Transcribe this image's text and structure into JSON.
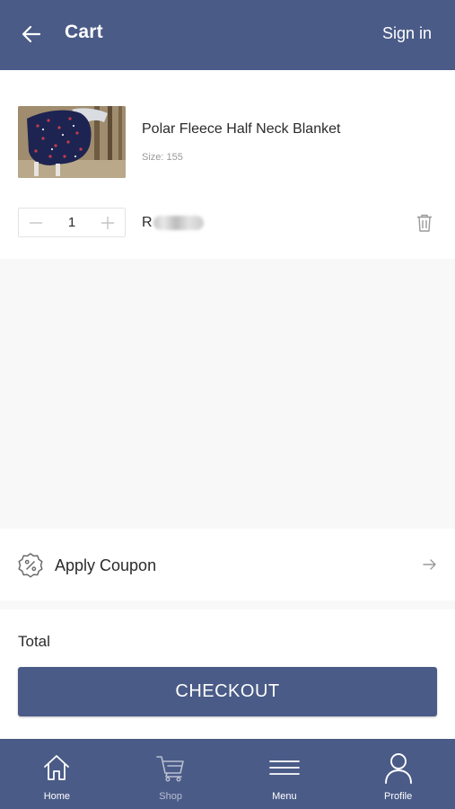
{
  "header": {
    "title": "Cart",
    "sign_in_label": "Sign in",
    "back_icon": "arrow-left-icon"
  },
  "cart": {
    "items": [
      {
        "name": "Polar Fleece Half Neck Blanket",
        "size_label": "Size: 155",
        "quantity": "1",
        "price_prefix": "R",
        "price_obscured": true
      }
    ]
  },
  "coupon": {
    "label": "Apply Coupon",
    "icon": "percent-badge-icon"
  },
  "total": {
    "label": "Total"
  },
  "checkout": {
    "label": "CHECKOUT"
  },
  "bottom_nav": {
    "items": [
      {
        "label": "Home",
        "icon": "home-icon",
        "active": true
      },
      {
        "label": "Shop",
        "icon": "cart-icon",
        "active": false
      },
      {
        "label": "Menu",
        "icon": "menu-icon",
        "active": true
      },
      {
        "label": "Profile",
        "icon": "user-icon",
        "active": true
      }
    ]
  },
  "colors": {
    "primary": "#4a5b87",
    "background": "#f8f8f8",
    "muted_text": "#9a9a9a"
  }
}
